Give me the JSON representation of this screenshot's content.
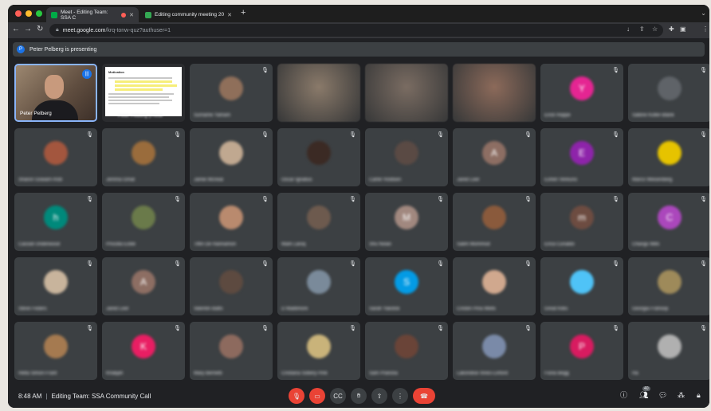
{
  "browser": {
    "tabs": [
      {
        "title": "Meet - Editing Team: SSA C",
        "favicon_color": "#00ac47"
      },
      {
        "title": "Editing community meeting 20",
        "favicon_color": "#34a853"
      }
    ],
    "new_tab_label": "+",
    "url_host": "meet.google.com",
    "url_path": "/krq-tonw-quz?authuser=1"
  },
  "presenting_bar": {
    "avatar_initial": "P",
    "text": "Peter Pelberg is presenting"
  },
  "main_tile": {
    "name": "Peter Pelberg"
  },
  "slide_tile": {
    "slide_title": "Motivation",
    "name": "Peter Pelberg (Prese"
  },
  "participants": [
    {
      "name": "Surname Yamam",
      "color": "#8f6f5a",
      "initial": ""
    },
    {
      "name": "",
      "color": "#8a7a6a",
      "video": true
    },
    {
      "name": "",
      "color": "#7a6c62",
      "video": true
    },
    {
      "name": "",
      "color": "#8c6a5a",
      "video": true
    },
    {
      "name": "Erick Hoppe",
      "color": "#e52592",
      "initial": "Y"
    },
    {
      "name": "Sabine Koller-Blank",
      "color": "#5f6368",
      "initial": ""
    },
    {
      "name": "Sharon Gowarn-Rob",
      "color": "#a3563e",
      "initial": ""
    },
    {
      "name": "Jemma Gmat",
      "color": "#9a6c3c",
      "initial": ""
    },
    {
      "name": "Jamie Mcneal",
      "color": "#c0a890",
      "initial": ""
    },
    {
      "name": "Oscar Ignatius",
      "color": "#3b2a24",
      "initial": ""
    },
    {
      "name": "Carter Roldsen",
      "color": "#5a4a44",
      "initial": ""
    },
    {
      "name": "Jared Leer",
      "color": "#8d6e63",
      "initial": "A"
    },
    {
      "name": "Eshen Vereuno",
      "color": "#8e24aa",
      "initial": "E"
    },
    {
      "name": "Marco Weisenberg",
      "color": "#e6c300",
      "initial": ""
    },
    {
      "name": "Cassidi Underwood",
      "color": "#00897b",
      "initial": "h"
    },
    {
      "name": "Priscilla Eckle",
      "color": "#6a7a4a",
      "initial": ""
    },
    {
      "name": "Tiffin De Hannamon",
      "color": "#b98a6e",
      "initial": ""
    },
    {
      "name": "Mark Laroq",
      "color": "#6d5a4e",
      "initial": ""
    },
    {
      "name": "Shu Nolan",
      "color": "#a1887f",
      "initial": "M"
    },
    {
      "name": "Salim Mommod",
      "color": "#8a5a3c",
      "initial": ""
    },
    {
      "name": "Erica Cunaldo",
      "color": "#6d4c41",
      "initial": "m"
    },
    {
      "name": "Changs Mills",
      "color": "#ab47bc",
      "initial": "C"
    },
    {
      "name": "Steve Feders",
      "color": "#c8b49c",
      "initial": ""
    },
    {
      "name": "Jared Leer",
      "color": "#8d6e63",
      "initial": "A"
    },
    {
      "name": "Valentin Batts",
      "color": "#5d4a40",
      "initial": ""
    },
    {
      "name": "D Maillimore",
      "color": "#7a8a9a",
      "initial": ""
    },
    {
      "name": "Sarah Yakotsk",
      "color": "#039be5",
      "initial": "S"
    },
    {
      "name": "Cristen Pina Wells",
      "color": "#d0a88e",
      "initial": ""
    },
    {
      "name": "Great Kilks",
      "color": "#4fc3f7",
      "initial": ""
    },
    {
      "name": "Georgia Frahoop",
      "color": "#9e8a5a",
      "initial": ""
    },
    {
      "name": "Hella Simon-Frant",
      "color": "#a57a50",
      "initial": ""
    },
    {
      "name": "Khalijah",
      "color": "#e91e63",
      "initial": "K"
    },
    {
      "name": "Mary Bernetti",
      "color": "#8d6a5e",
      "initial": ""
    },
    {
      "name": "Cristiana Sobery Pink",
      "color": "#c9b37a",
      "initial": ""
    },
    {
      "name": "Sam Prancka",
      "color": "#6a4438",
      "initial": ""
    },
    {
      "name": "Lakondise Innes-Linford",
      "color": "#7a8aa8",
      "initial": ""
    },
    {
      "name": "Fiona Begg",
      "color": "#d81b60",
      "initial": "P"
    },
    {
      "name": "Ha",
      "color": "#b0b0b0",
      "initial": ""
    }
  ],
  "bottom": {
    "time": "8:48 AM",
    "meeting": "Editing Team: SSA Community Call",
    "participant_count": "40"
  },
  "icons": {
    "mic": "mic-off-icon",
    "cam": "camera-off-icon",
    "cc": "captions-icon",
    "hand": "raise-hand-icon",
    "present": "present-icon",
    "more": "more-options-icon",
    "end": "end-call-icon"
  }
}
